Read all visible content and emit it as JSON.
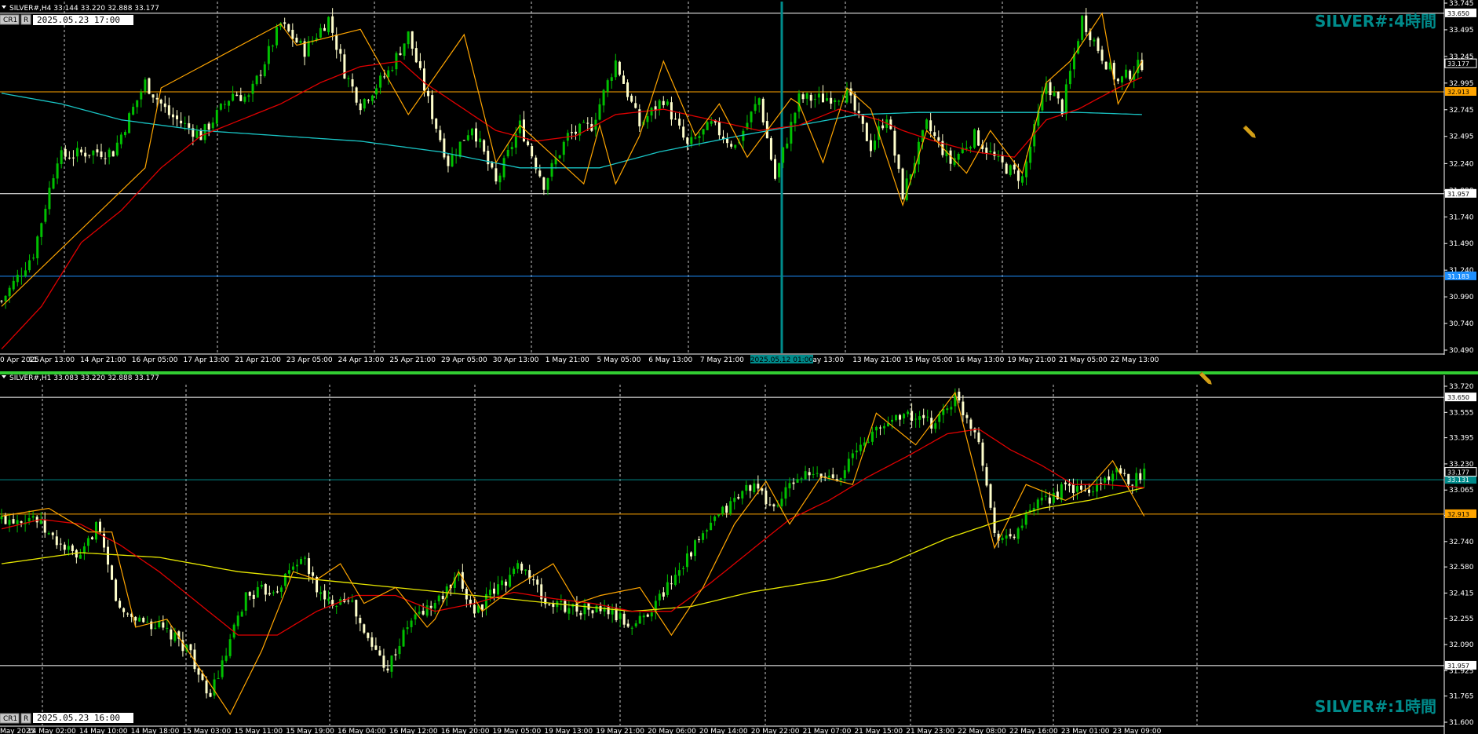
{
  "colors": {
    "background": "#000000",
    "bull": "#00c000",
    "bear": "#ffffcc",
    "ma_fast": "#e00000",
    "ma_slow_h4": "#19c5c5",
    "ma_slow_h1": "#e8e800",
    "zigzag": "#ffa500",
    "level_white": "#ffffff",
    "level_orange": "#ffa500",
    "level_blue": "#1e90ff",
    "level_teal": "#008b8b",
    "title_text": "#008b8b",
    "separator": "#32cd32"
  },
  "chart_data": [
    {
      "type": "candlestick",
      "symbol_header": "SILVER#,H4  33.144 33.220 32.888 33.177",
      "button_labels": [
        "CR1",
        "R"
      ],
      "datetime_box": "2025.05.23 17:00",
      "title": "SILVER#:4時間",
      "ylim": [
        30.49,
        33.745
      ],
      "y_ticks": [
        "33.745",
        "33.495",
        "33.245",
        "32.995",
        "32.745",
        "32.495",
        "32.240",
        "31.990",
        "31.740",
        "31.490",
        "31.240",
        "30.990",
        "30.740",
        "30.490"
      ],
      "x_labels": [
        "0 Apr 2025",
        "11 Apr 13:00",
        "14 Apr 21:00",
        "16 Apr 05:00",
        "17 Apr 13:00",
        "21 Apr 21:00",
        "23 Apr 05:00",
        "24 Apr 13:00",
        "25 Apr 21:00",
        "29 Apr 05:00",
        "30 Apr 13:00",
        "1 May 21:00",
        "5 May 05:00",
        "6 May 13:00",
        "7 May 21:00",
        "2025.05.12 01:00",
        "May 13:00",
        "13 May 21:00",
        "15 May 05:00",
        "16 May 13:00",
        "19 May 21:00",
        "21 May 05:00",
        "22 May 13:00"
      ],
      "crosshair_label": "2025.05.12 01:00",
      "levels": [
        {
          "value": 33.65,
          "label": "33.650",
          "color": "#ffffff"
        },
        {
          "value": 32.913,
          "label": "32.913",
          "color": "#ffa500"
        },
        {
          "value": 31.957,
          "label": "31.957",
          "color": "#ffffff"
        },
        {
          "value": 31.183,
          "label": "31.183",
          "color": "#1e90ff"
        }
      ],
      "price_tag": {
        "value": 33.177,
        "label": "33.177"
      },
      "close_anchors": [
        [
          0,
          30.95
        ],
        [
          8,
          31.4
        ],
        [
          14,
          32.3
        ],
        [
          22,
          32.35
        ],
        [
          28,
          32.35
        ],
        [
          36,
          33.0
        ],
        [
          42,
          32.7
        ],
        [
          50,
          32.5
        ],
        [
          58,
          32.9
        ],
        [
          62,
          32.85
        ],
        [
          70,
          33.55
        ],
        [
          76,
          33.3
        ],
        [
          82,
          33.6
        ],
        [
          86,
          33.1
        ],
        [
          90,
          32.8
        ],
        [
          97,
          33.1
        ],
        [
          102,
          33.45
        ],
        [
          108,
          32.7
        ],
        [
          112,
          32.25
        ],
        [
          118,
          32.6
        ],
        [
          124,
          32.05
        ],
        [
          130,
          32.6
        ],
        [
          136,
          32.05
        ],
        [
          142,
          32.5
        ],
        [
          148,
          32.6
        ],
        [
          154,
          33.2
        ],
        [
          160,
          32.6
        ],
        [
          166,
          32.85
        ],
        [
          172,
          32.4
        ],
        [
          178,
          32.6
        ],
        [
          184,
          32.4
        ],
        [
          190,
          32.85
        ],
        [
          194,
          32.1
        ],
        [
          200,
          32.85
        ],
        [
          206,
          32.85
        ],
        [
          212,
          32.9
        ],
        [
          218,
          32.4
        ],
        [
          222,
          32.7
        ],
        [
          226,
          31.95
        ],
        [
          232,
          32.6
        ],
        [
          238,
          32.25
        ],
        [
          244,
          32.5
        ],
        [
          250,
          32.25
        ],
        [
          256,
          32.1
        ],
        [
          262,
          33.0
        ],
        [
          266,
          32.75
        ],
        [
          271,
          33.6
        ],
        [
          276,
          33.25
        ],
        [
          280,
          33.0
        ],
        [
          286,
          33.18
        ]
      ],
      "ma_fast_anchors": [
        [
          0,
          30.5
        ],
        [
          10,
          30.9
        ],
        [
          20,
          31.5
        ],
        [
          30,
          31.8
        ],
        [
          40,
          32.2
        ],
        [
          50,
          32.5
        ],
        [
          60,
          32.65
        ],
        [
          70,
          32.8
        ],
        [
          80,
          33.0
        ],
        [
          90,
          33.15
        ],
        [
          100,
          33.2
        ],
        [
          106,
          33.0
        ],
        [
          114,
          32.8
        ],
        [
          124,
          32.55
        ],
        [
          134,
          32.45
        ],
        [
          144,
          32.5
        ],
        [
          154,
          32.7
        ],
        [
          166,
          32.75
        ],
        [
          178,
          32.65
        ],
        [
          190,
          32.55
        ],
        [
          200,
          32.6
        ],
        [
          210,
          32.75
        ],
        [
          220,
          32.65
        ],
        [
          226,
          32.55
        ],
        [
          234,
          32.45
        ],
        [
          244,
          32.35
        ],
        [
          254,
          32.3
        ],
        [
          262,
          32.65
        ],
        [
          270,
          32.75
        ],
        [
          280,
          32.95
        ],
        [
          286,
          33.05
        ]
      ],
      "ma_slow_anchors": [
        [
          0,
          32.9
        ],
        [
          15,
          32.8
        ],
        [
          30,
          32.65
        ],
        [
          50,
          32.55
        ],
        [
          70,
          32.5
        ],
        [
          90,
          32.45
        ],
        [
          110,
          32.35
        ],
        [
          130,
          32.2
        ],
        [
          150,
          32.2
        ],
        [
          165,
          32.35
        ],
        [
          185,
          32.5
        ],
        [
          200,
          32.6
        ],
        [
          215,
          32.7
        ],
        [
          230,
          32.72
        ],
        [
          250,
          32.72
        ],
        [
          270,
          32.72
        ],
        [
          286,
          32.7
        ]
      ],
      "zigzag": [
        [
          0,
          30.9
        ],
        [
          36,
          32.2
        ],
        [
          40,
          32.95
        ],
        [
          70,
          33.55
        ],
        [
          74,
          33.35
        ],
        [
          90,
          33.5
        ],
        [
          102,
          32.7
        ],
        [
          116,
          33.45
        ],
        [
          124,
          32.25
        ],
        [
          130,
          32.6
        ],
        [
          146,
          32.05
        ],
        [
          150,
          32.6
        ],
        [
          154,
          32.05
        ],
        [
          160,
          32.5
        ],
        [
          166,
          33.2
        ],
        [
          174,
          32.5
        ],
        [
          180,
          32.8
        ],
        [
          187,
          32.3
        ],
        [
          198,
          32.85
        ],
        [
          200,
          32.8
        ],
        [
          206,
          32.25
        ],
        [
          212,
          32.95
        ],
        [
          218,
          32.75
        ],
        [
          226,
          31.85
        ],
        [
          232,
          32.55
        ],
        [
          242,
          32.15
        ],
        [
          248,
          32.55
        ],
        [
          256,
          32.15
        ],
        [
          262,
          33.0
        ],
        [
          268,
          33.2
        ],
        [
          276,
          33.65
        ],
        [
          280,
          32.8
        ],
        [
          286,
          33.2
        ]
      ]
    },
    {
      "type": "candlestick",
      "symbol_header": "SILVER#,H1  33.083 33.220 32.888 33.177",
      "button_labels": [
        "CR1",
        "R"
      ],
      "datetime_box": "2025.05.23 16:00",
      "title": "SILVER#:1時間",
      "ylim": [
        31.6,
        33.72
      ],
      "y_ticks": [
        "33.720",
        "33.555",
        "33.395",
        "33.230",
        "33.065",
        "32.905",
        "32.740",
        "32.580",
        "32.415",
        "32.255",
        "32.090",
        "31.925",
        "31.765",
        "31.600"
      ],
      "x_labels": [
        "May 2025",
        "14 May 02:00",
        "14 May 10:00",
        "14 May 18:00",
        "15 May 03:00",
        "15 May 11:00",
        "15 May 19:00",
        "16 May 04:00",
        "16 May 12:00",
        "16 May 20:00",
        "19 May 05:00",
        "19 May 13:00",
        "19 May 21:00",
        "20 May 06:00",
        "20 May 14:00",
        "20 May 22:00",
        "21 May 07:00",
        "21 May 15:00",
        "21 May 23:00",
        "22 May 08:00",
        "22 May 16:00",
        "23 May 01:00",
        "23 May 09:00"
      ],
      "levels": [
        {
          "value": 33.65,
          "label": "33.650",
          "color": "#ffffff"
        },
        {
          "value": 33.13,
          "label": "33.131",
          "color": "#008b8b"
        },
        {
          "value": 32.913,
          "label": "32.913",
          "color": "#ffa500"
        },
        {
          "value": 31.957,
          "label": "31.957",
          "color": "#ffffff"
        }
      ],
      "price_tag": {
        "value": 33.177,
        "label": "33.177"
      },
      "close_anchors": [
        [
          0,
          32.88
        ],
        [
          8,
          32.9
        ],
        [
          12,
          32.78
        ],
        [
          20,
          32.62
        ],
        [
          24,
          32.85
        ],
        [
          30,
          32.3
        ],
        [
          40,
          32.2
        ],
        [
          48,
          32.05
        ],
        [
          52,
          31.75
        ],
        [
          56,
          31.95
        ],
        [
          62,
          32.4
        ],
        [
          70,
          32.45
        ],
        [
          76,
          32.65
        ],
        [
          82,
          32.35
        ],
        [
          88,
          32.4
        ],
        [
          92,
          32.15
        ],
        [
          98,
          31.95
        ],
        [
          104,
          32.25
        ],
        [
          110,
          32.35
        ],
        [
          116,
          32.5
        ],
        [
          120,
          32.3
        ],
        [
          128,
          32.5
        ],
        [
          132,
          32.6
        ],
        [
          138,
          32.35
        ],
        [
          146,
          32.32
        ],
        [
          154,
          32.3
        ],
        [
          160,
          32.2
        ],
        [
          166,
          32.35
        ],
        [
          174,
          32.65
        ],
        [
          182,
          32.9
        ],
        [
          190,
          33.1
        ],
        [
          196,
          32.95
        ],
        [
          202,
          33.15
        ],
        [
          212,
          33.15
        ],
        [
          220,
          33.4
        ],
        [
          228,
          33.55
        ],
        [
          236,
          33.48
        ],
        [
          242,
          33.65
        ],
        [
          248,
          33.4
        ],
        [
          252,
          32.8
        ],
        [
          256,
          32.75
        ],
        [
          262,
          32.95
        ],
        [
          270,
          33.08
        ],
        [
          276,
          33.05
        ],
        [
          282,
          33.18
        ],
        [
          286,
          33.12
        ],
        [
          290,
          33.18
        ]
      ],
      "ma_fast_anchors": [
        [
          0,
          32.82
        ],
        [
          10,
          32.88
        ],
        [
          20,
          32.85
        ],
        [
          30,
          32.72
        ],
        [
          40,
          32.55
        ],
        [
          50,
          32.35
        ],
        [
          60,
          32.15
        ],
        [
          70,
          32.15
        ],
        [
          80,
          32.3
        ],
        [
          90,
          32.4
        ],
        [
          100,
          32.4
        ],
        [
          110,
          32.3
        ],
        [
          120,
          32.35
        ],
        [
          130,
          32.42
        ],
        [
          140,
          32.38
        ],
        [
          150,
          32.35
        ],
        [
          160,
          32.3
        ],
        [
          170,
          32.3
        ],
        [
          180,
          32.48
        ],
        [
          190,
          32.68
        ],
        [
          200,
          32.88
        ],
        [
          210,
          33.0
        ],
        [
          220,
          33.15
        ],
        [
          230,
          33.28
        ],
        [
          240,
          33.42
        ],
        [
          248,
          33.45
        ],
        [
          256,
          33.32
        ],
        [
          264,
          33.22
        ],
        [
          272,
          33.1
        ],
        [
          280,
          33.1
        ],
        [
          290,
          33.08
        ]
      ],
      "ma_slow_anchors": [
        [
          0,
          32.6
        ],
        [
          20,
          32.67
        ],
        [
          40,
          32.64
        ],
        [
          60,
          32.55
        ],
        [
          80,
          32.5
        ],
        [
          100,
          32.45
        ],
        [
          120,
          32.4
        ],
        [
          140,
          32.35
        ],
        [
          160,
          32.3
        ],
        [
          175,
          32.33
        ],
        [
          190,
          32.42
        ],
        [
          210,
          32.5
        ],
        [
          225,
          32.6
        ],
        [
          240,
          32.76
        ],
        [
          252,
          32.86
        ],
        [
          264,
          32.95
        ],
        [
          276,
          33.0
        ],
        [
          290,
          33.08
        ]
      ],
      "zigzag": [
        [
          0,
          32.9
        ],
        [
          12,
          32.95
        ],
        [
          22,
          32.8
        ],
        [
          28,
          32.8
        ],
        [
          34,
          32.2
        ],
        [
          42,
          32.25
        ],
        [
          58,
          31.65
        ],
        [
          66,
          32.05
        ],
        [
          74,
          32.55
        ],
        [
          80,
          32.5
        ],
        [
          86,
          32.6
        ],
        [
          92,
          32.35
        ],
        [
          100,
          32.45
        ],
        [
          108,
          32.2
        ],
        [
          110,
          32.25
        ],
        [
          116,
          32.55
        ],
        [
          122,
          32.3
        ],
        [
          130,
          32.45
        ],
        [
          140,
          32.6
        ],
        [
          146,
          32.35
        ],
        [
          152,
          32.4
        ],
        [
          162,
          32.45
        ],
        [
          170,
          32.15
        ],
        [
          178,
          32.45
        ],
        [
          186,
          32.85
        ],
        [
          194,
          33.12
        ],
        [
          200,
          32.85
        ],
        [
          208,
          33.15
        ],
        [
          216,
          33.1
        ],
        [
          222,
          33.55
        ],
        [
          232,
          33.35
        ],
        [
          242,
          33.68
        ],
        [
          252,
          32.7
        ],
        [
          260,
          33.1
        ],
        [
          270,
          33.0
        ],
        [
          276,
          33.08
        ],
        [
          282,
          33.25
        ],
        [
          290,
          32.9
        ]
      ]
    }
  ]
}
